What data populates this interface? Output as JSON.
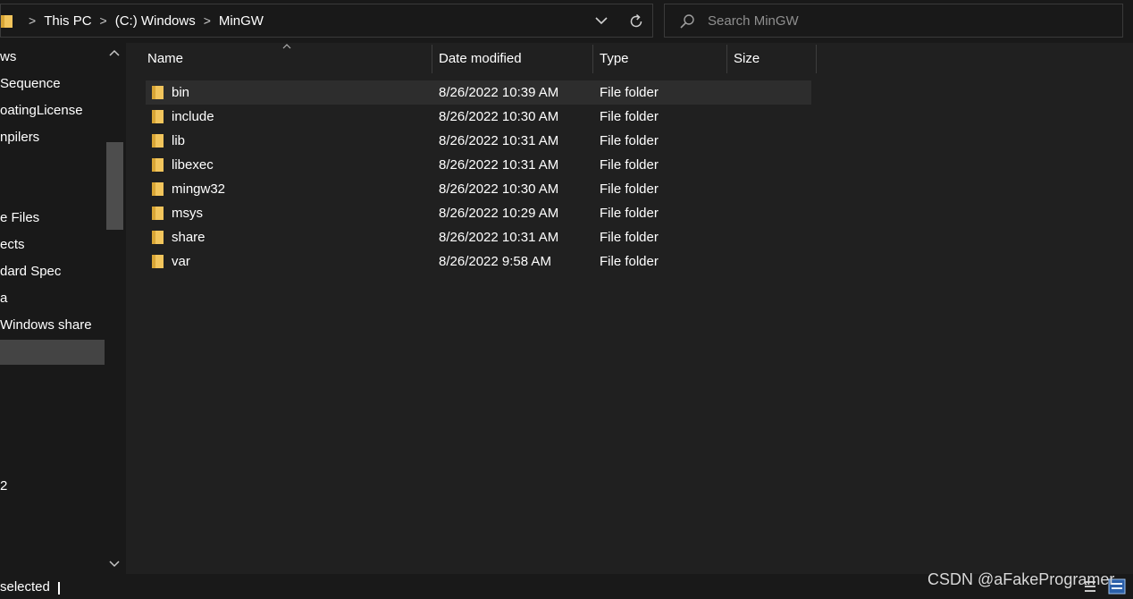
{
  "address": {
    "breadcrumbs": [
      "This PC",
      "(C:) Windows",
      "MinGW"
    ]
  },
  "search": {
    "placeholder": "Search MinGW"
  },
  "nav": {
    "items": [
      {
        "label": "ws"
      },
      {
        "label": "Sequence"
      },
      {
        "label": "oatingLicense"
      },
      {
        "label": "npilers"
      },
      {
        "label": "e Files"
      },
      {
        "label": "ects"
      },
      {
        "label": "dard Spec"
      },
      {
        "label": "a"
      },
      {
        "label": " Windows share"
      },
      {
        "label": ""
      },
      {
        "label": "2"
      }
    ]
  },
  "columns": {
    "name": "Name",
    "date": "Date modified",
    "type": "Type",
    "size": "Size"
  },
  "files": [
    {
      "name": "bin",
      "date": "8/26/2022 10:39 AM",
      "type": "File folder"
    },
    {
      "name": "include",
      "date": "8/26/2022 10:30 AM",
      "type": "File folder"
    },
    {
      "name": "lib",
      "date": "8/26/2022 10:31 AM",
      "type": "File folder"
    },
    {
      "name": "libexec",
      "date": "8/26/2022 10:31 AM",
      "type": "File folder"
    },
    {
      "name": "mingw32",
      "date": "8/26/2022 10:30 AM",
      "type": "File folder"
    },
    {
      "name": "msys",
      "date": "8/26/2022 10:29 AM",
      "type": "File folder"
    },
    {
      "name": "share",
      "date": "8/26/2022 10:31 AM",
      "type": "File folder"
    },
    {
      "name": "var",
      "date": "8/26/2022 9:58 AM",
      "type": "File folder"
    }
  ],
  "status": {
    "text": "selected"
  },
  "watermark": "CSDN @aFakeProgramer",
  "colors": {
    "folder": "#f2c55c",
    "folder_dark": "#d9a636"
  }
}
